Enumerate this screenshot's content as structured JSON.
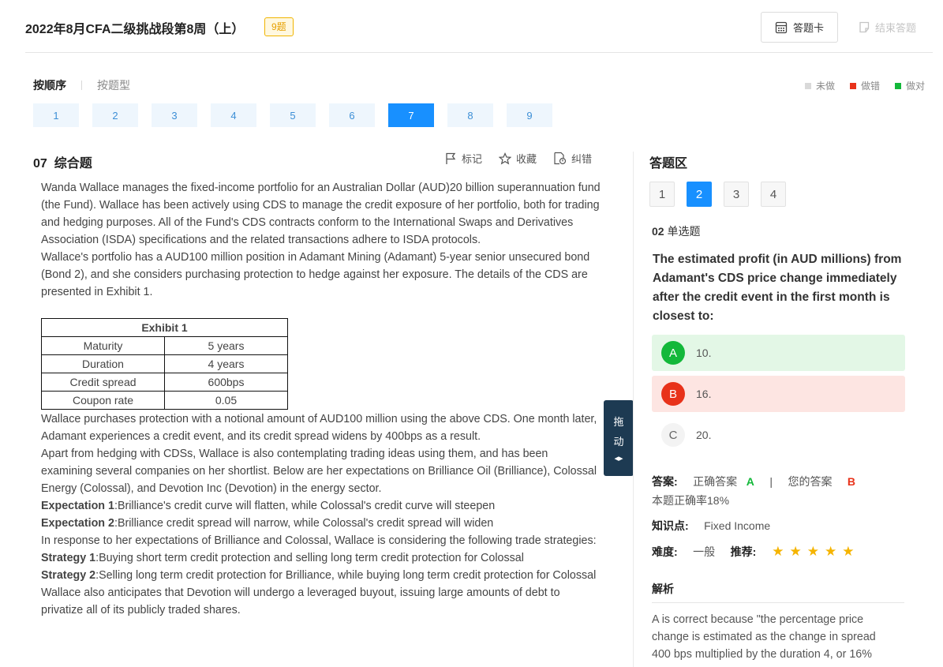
{
  "header": {
    "title": "2022年8月CFA二级挑战段第8周（上）",
    "count_badge": "9题",
    "answer_card": "答题卡",
    "end_answer": "结束答题"
  },
  "tabs": {
    "by_order": "按顺序",
    "by_type": "按题型"
  },
  "legend": [
    {
      "label": "未做",
      "color": "#d9d9d9"
    },
    {
      "label": "做错",
      "color": "#e8321a"
    },
    {
      "label": "做对",
      "color": "#13b83a"
    }
  ],
  "question_nav": {
    "items": [
      "1",
      "2",
      "3",
      "4",
      "5",
      "6",
      "7",
      "8",
      "9"
    ],
    "active": "7"
  },
  "question": {
    "number": "07",
    "type": "综合题",
    "tools": {
      "mark": "标记",
      "favorite": "收藏",
      "report": "纠错"
    }
  },
  "passage": {
    "p1": "Wanda Wallace manages the fixed-income portfolio for an Australian Dollar (AUD)20 billion superannuation fund (the Fund). Wallace has been actively using CDS to manage the credit exposure of her portfolio, both for trading and hedging purposes. All of the Fund's CDS contracts conform to the International Swaps and Derivatives Association (ISDA) specifications and the related transactions adhere to ISDA protocols.",
    "p2": "Wallace's portfolio has a AUD100 million position in Adamant Mining (Adamant) 5-year senior unsecured bond (Bond 2), and she considers purchasing protection to hedge against her exposure. The details of the CDS are presented in Exhibit 1.",
    "exhibit": {
      "title": "Exhibit 1",
      "rows": [
        {
          "label": "Maturity",
          "value": "5 years"
        },
        {
          "label": "Duration",
          "value": "4 years"
        },
        {
          "label": "Credit spread",
          "value": "600bps"
        },
        {
          "label": "Coupon rate",
          "value": "0.05"
        }
      ]
    },
    "p3": "Wallace purchases protection with a notional amount of AUD100 million using the above CDS. One month later, Adamant experiences a credit event, and its credit spread widens by 400bps as a result.",
    "p4": "Apart from hedging with CDSs, Wallace is also contemplating trading ideas using them, and has been examining several companies on her shortlist. Below are her expectations on Brilliance Oil (Brilliance), Colossal Energy (Colossal), and Devotion Inc (Devotion) in the energy sector.",
    "exp1_label": "Expectation 1",
    "exp1_text": ":Brilliance's credit curve will flatten, while Colossal's credit curve will steepen",
    "exp2_label": "Expectation 2",
    "exp2_text": ":Brilliance credit spread will narrow, while Colossal's credit spread will widen",
    "p5": "In response to her expectations of Brilliance and Colossal, Wallace is considering the following trade strategies:",
    "str1_label": "Strategy 1",
    "str1_text": ":Buying short term credit protection and selling long term credit protection for Colossal",
    "str2_label": "Strategy 2",
    "str2_text": ":Selling long term credit protection for Brilliance, while buying long term credit protection for Colossal",
    "p6": "Wallace also anticipates that Devotion will undergo a leveraged buyout, issuing large amounts of debt to privatize all of its publicly traded shares."
  },
  "drag_handle": {
    "char1": "拖",
    "char2": "动",
    "arrows": "◂▸"
  },
  "answer_area": {
    "title": "答题区",
    "sub_questions": [
      "1",
      "2",
      "3",
      "4"
    ],
    "active_sub": "2",
    "sub_number": "02",
    "sub_type": "单选题",
    "stem": "The estimated profit (in AUD millions) from Adamant's CDS price change immediately after the credit event in the first month is closest to:",
    "options": [
      {
        "letter": "A",
        "text": "10.",
        "state": "correct"
      },
      {
        "letter": "B",
        "text": "16.",
        "state": "wrong"
      },
      {
        "letter": "C",
        "text": "20.",
        "state": "none"
      }
    ],
    "answer_label": "答案:",
    "correct_label": "正确答案",
    "correct_value": "A",
    "separator": "|",
    "your_label": "您的答案",
    "your_value": "B",
    "accuracy": "本题正确率18%",
    "knowledge_label": "知识点:",
    "knowledge_value": "Fixed Income",
    "difficulty_label": "难度:",
    "difficulty_value": "一般",
    "recommend_label": "推荐:",
    "recommend_stars": 5,
    "analysis_title": "解析",
    "analysis_text": "A is correct because \"the percentage price change is estimated as the change in spread 400 bps multiplied by the duration 4, or 16%"
  },
  "colors": {
    "accent": "#1890ff",
    "correct": "#13b83a",
    "wrong": "#e8321a",
    "badge": "#e6a000",
    "drag_bg": "#1d3a52"
  }
}
